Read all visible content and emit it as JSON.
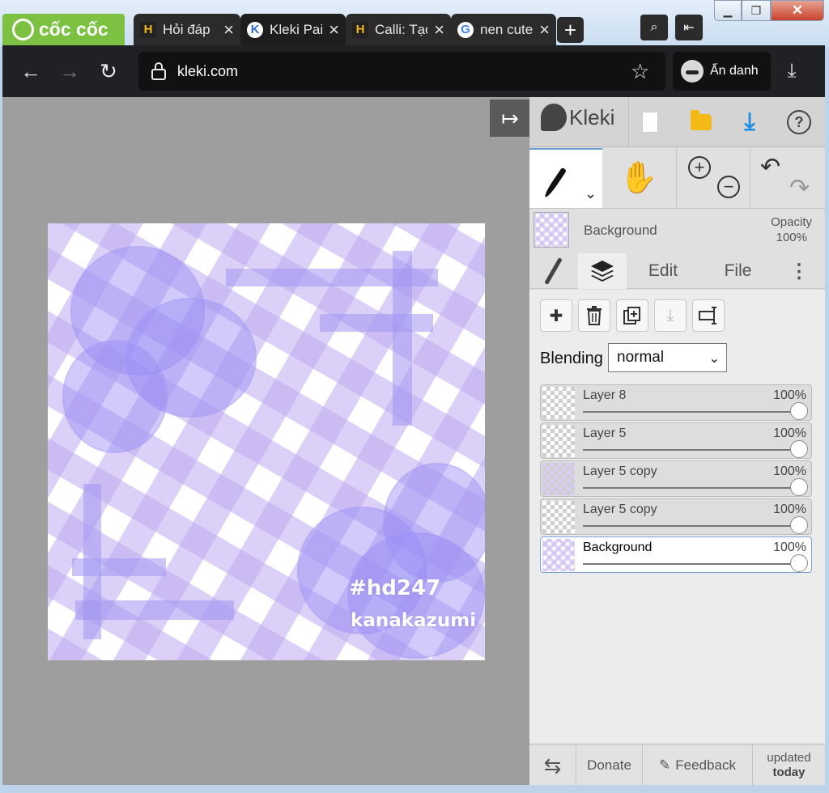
{
  "browser": {
    "brand": "cốc cốc",
    "tabs": [
      {
        "title": "Hỏi đáp",
        "favicon": "H",
        "favicon_color": "#f5b915"
      },
      {
        "title": "Kleki Paint",
        "favicon": "K",
        "favicon_color": "#2f6ad8"
      },
      {
        "title": "Calli: Tạo",
        "favicon": "H",
        "favicon_color": "#f5b915"
      },
      {
        "title": "nen cute",
        "favicon": "G",
        "favicon_color": "#4285f4"
      }
    ],
    "new_tab": "+",
    "url": "kleki.com",
    "incognito_label": "Ẩn danh"
  },
  "canvas": {
    "hashtag": "#hd247",
    "signature": "kanakazumi"
  },
  "app": {
    "logo_text": "Kleki",
    "current_layer": {
      "name": "Background",
      "opacity_label": "Opacity",
      "opacity_value": "100%"
    },
    "tabs": {
      "edit": "Edit",
      "file": "File",
      "more": "⋮"
    },
    "blending_label": "Blending",
    "blending_mode": "normal",
    "layers": [
      {
        "name": "Layer 8",
        "opacity": "100%",
        "selected": false
      },
      {
        "name": "Layer 5",
        "opacity": "100%",
        "selected": false
      },
      {
        "name": "Layer 5 copy",
        "opacity": "100%",
        "selected": false
      },
      {
        "name": "Layer 5 copy",
        "opacity": "100%",
        "selected": false
      },
      {
        "name": "Background",
        "opacity": "100%",
        "selected": true
      }
    ],
    "footer": {
      "donate": "Donate",
      "feedback": "Feedback",
      "updated_line1": "updated",
      "updated_line2": "today"
    }
  },
  "colors": {
    "accent_blue": "#1a8ce0",
    "folder_yellow": "#f5b915",
    "brand_green": "#7cc142"
  }
}
